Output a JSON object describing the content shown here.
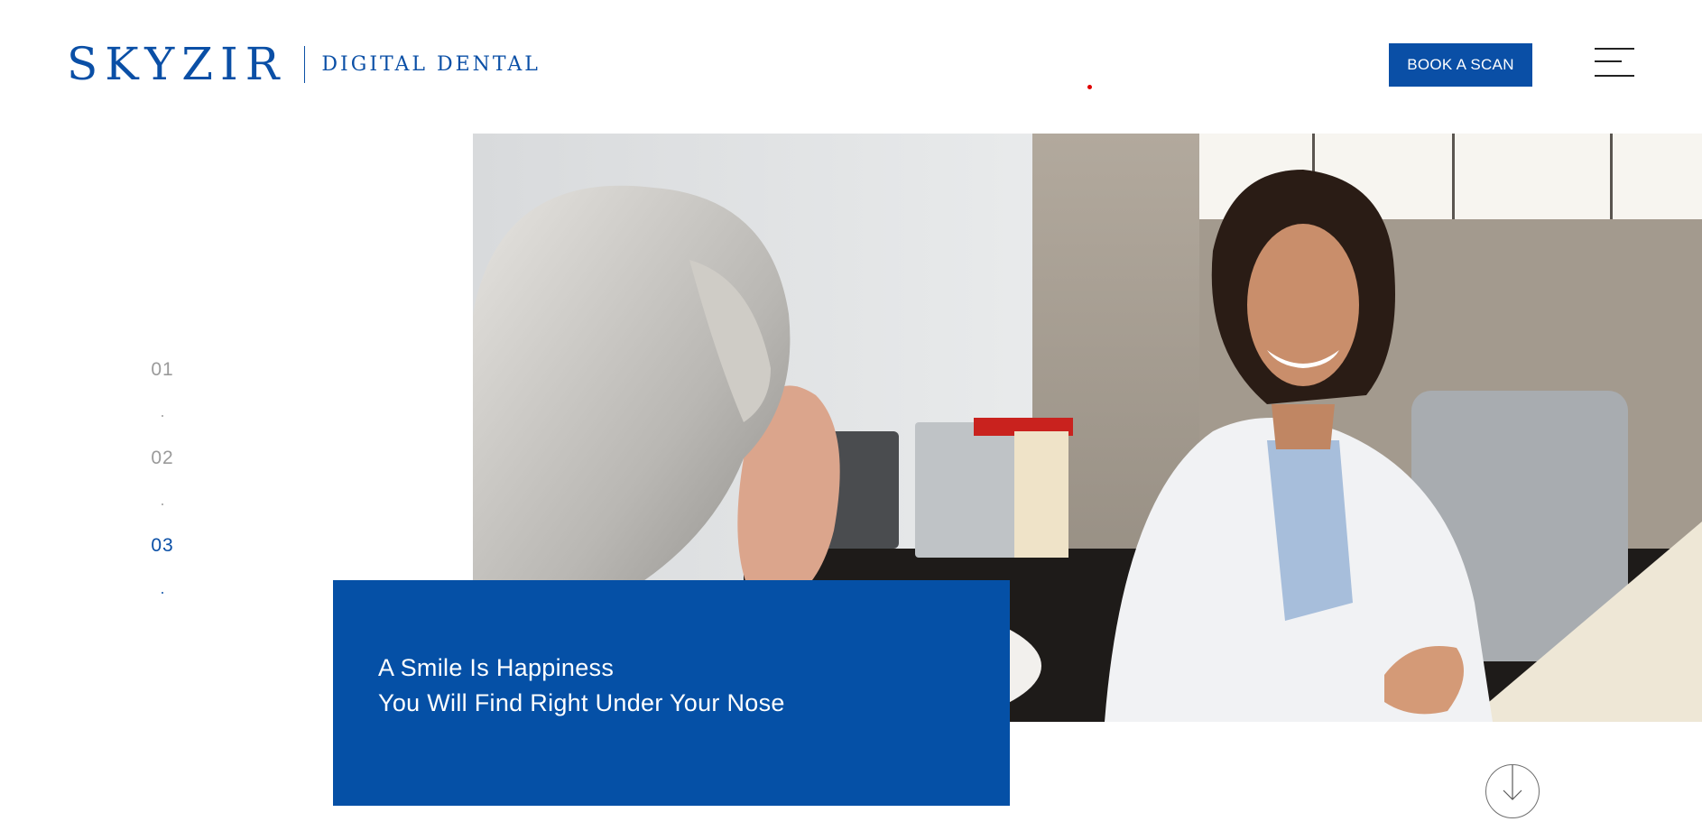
{
  "header": {
    "logo_main": "SKYZIR",
    "logo_sub": "DIGITAL DENTAL",
    "cta_label": "BOOK A SCAN",
    "menu_icon": "hamburger-icon"
  },
  "slides": {
    "items": [
      {
        "label": "01",
        "active": false
      },
      {
        "label": "02",
        "active": false
      },
      {
        "label": "03",
        "active": true
      }
    ]
  },
  "hero": {
    "caption_line1": "A Smile Is Happiness",
    "caption_line2": "You Will Find Right Under Your Nose"
  },
  "scroll": {
    "icon": "arrow-down-icon"
  },
  "colors": {
    "brand": "#0a4fa6",
    "caption_bg": "#0550a6",
    "indicator_dot": "#e00000"
  }
}
